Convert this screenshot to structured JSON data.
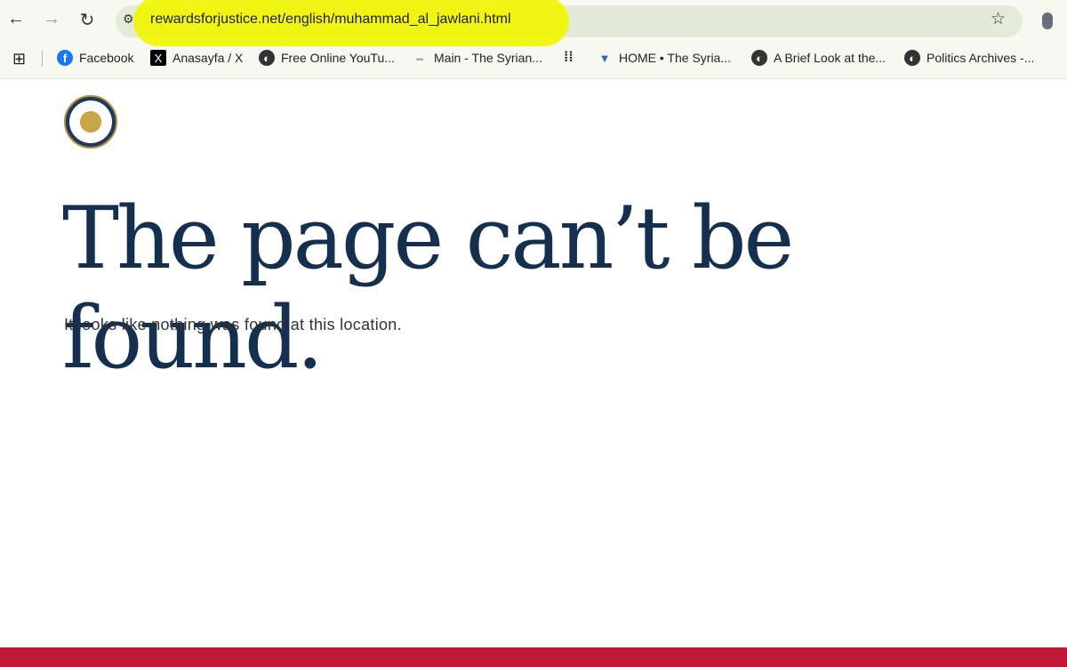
{
  "browser": {
    "url": "rewardsforjustice.net/english/muhammad_al_jawlani.html",
    "highlight_color": "#f1f60a",
    "bookmarks": [
      {
        "label": "Facebook",
        "icon": "facebook-icon"
      },
      {
        "label": "Anasayfa / X",
        "icon": "x-icon"
      },
      {
        "label": "Free Online YouTu...",
        "icon": "globe-icon"
      },
      {
        "label": "Main - The Syrian...",
        "icon": "site-icon"
      },
      {
        "label": "HOME • The Syria...",
        "icon": "site-icon"
      },
      {
        "label": "A Brief Look at the...",
        "icon": "globe-icon"
      },
      {
        "label": "Politics Archives -...",
        "icon": "globe-icon"
      }
    ]
  },
  "page": {
    "heading": "The page can’t be found.",
    "message": "It looks like nothing was found at this location.",
    "footer_color": "#bf1837"
  }
}
